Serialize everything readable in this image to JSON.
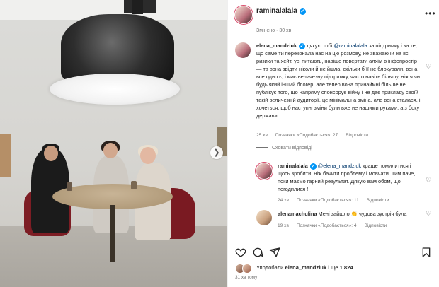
{
  "post": {
    "username": "raminalalala",
    "subtitle": "Змінено · 30 хв"
  },
  "comments": [
    {
      "username": "elena_mandziuk",
      "text_before": " дякую тобі ",
      "mention": "@raminalalala",
      "text_after": " за підтримку і за те, що саме ти переконала нас на цю розмову, не зважаючи на всі ризики та хейт. усі питають, навіщо повертати алхім в інфопростір — та вона звідти ніколи й не йшла! скільки б її не блокували, вона все одно є, і має величезну підтримку, часто навіть більшу, ніж я чи будь який інший блогер. але тепер вона принаймні більше не публікує того, що напряму спонсорує війну і не дає прикладу своїй такій величезній аудиторії. це мінімальна зміна, але вона сталася. і хочеться, щоб наступні зміни були вже не нашими руками, а з боку держави.",
      "meta": {
        "time": "25 хв",
        "likes": "Позначки «Подобається»: 27",
        "reply": "Відповісти"
      }
    },
    {
      "username": "raminalalala",
      "text_before": " ",
      "mention": "@elena_mandziuk",
      "text_after": " краще помилитися і щось зробити, ніж бачити проблему і мовчати. Тим паче, поки маємо гарний результат. Дякую вам обом, що погодилися !",
      "meta": {
        "time": "24 хв",
        "likes": "Позначки «Подобається»: 11",
        "reply": "Відповісти"
      }
    },
    {
      "username": "alenamachulina",
      "text_before": " Мені зайшло 👏 чудова зустріч була",
      "mention": "",
      "text_after": "",
      "meta": {
        "time": "19 хв",
        "likes": "Позначки «Подобається»: 4",
        "reply": "Відповісти"
      }
    }
  ],
  "hide_replies": "Сховати відповіді",
  "likes": {
    "prefix": "Уподобали ",
    "user": "elena_mandziuk",
    "middle": " і ще ",
    "count": "1 824"
  },
  "time_ago": "31 хв тому",
  "icons": [
    "heart-icon",
    "comment-icon",
    "share-icon",
    "bookmark-icon",
    "more-icon",
    "next-arrow-icon",
    "verified-icon"
  ],
  "colors": {
    "verified": "#0095f6",
    "mention": "#00376b",
    "muted": "#737373"
  }
}
